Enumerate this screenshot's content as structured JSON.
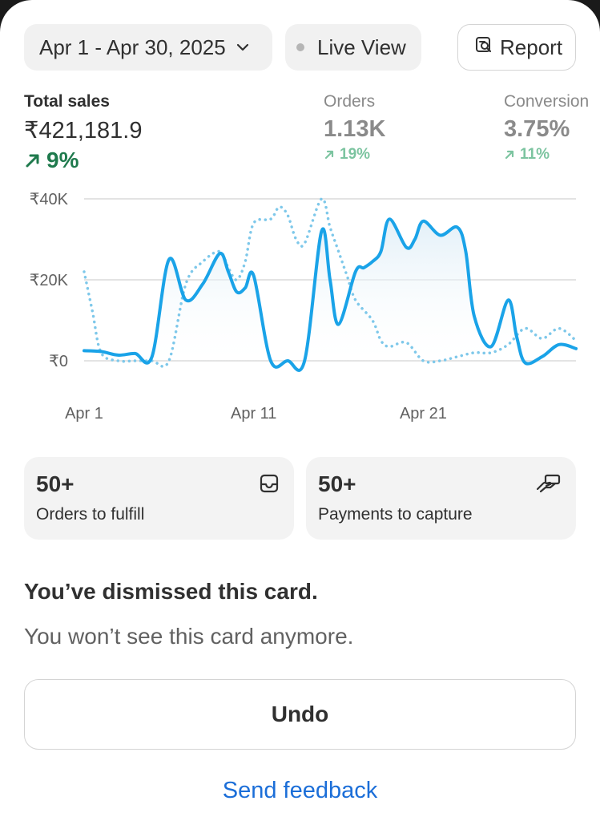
{
  "header": {
    "date_range": "Apr 1 - Apr 30, 2025",
    "live_view": "Live View",
    "report": "Report"
  },
  "metrics": [
    {
      "label": "Total sales",
      "value": "₹421,181.9",
      "delta": "9%"
    },
    {
      "label": "Orders",
      "value": "1.13K",
      "delta": "19%"
    },
    {
      "label": "Conversion",
      "value": "3.75%",
      "delta": "11%"
    }
  ],
  "colors": {
    "series_current": "#1aa3e8",
    "series_previous": "#7ec8ea",
    "positive": "#1f7a4d",
    "positive_muted": "#7cc4a0",
    "link": "#1b6ed8"
  },
  "chart_data": {
    "type": "line",
    "yticks": [
      "₹40K",
      "₹20K",
      "₹0"
    ],
    "xticks": [
      "Apr 1",
      "Apr 11",
      "Apr 21"
    ],
    "ylim": [
      0,
      40000
    ],
    "xlim": [
      1,
      30
    ],
    "grid": true,
    "series": [
      {
        "style": "solid",
        "x": [
          1,
          2,
          3,
          4,
          5,
          6,
          7,
          8,
          9,
          9.5,
          10,
          10.5,
          11,
          12,
          13,
          14,
          15,
          15.5,
          16,
          17,
          17.5,
          18,
          18.5,
          19,
          20,
          20.5,
          21,
          22,
          23,
          23.5,
          24,
          25,
          26,
          26.5,
          27,
          28,
          29,
          30
        ],
        "values": [
          2500,
          2300,
          1400,
          1800,
          1000,
          25000,
          15000,
          19000,
          26500,
          22000,
          17000,
          18000,
          21000,
          0,
          0,
          0,
          32000,
          20000,
          9000,
          22000,
          23000,
          24500,
          27000,
          35000,
          28000,
          30000,
          34500,
          31000,
          33000,
          27000,
          11000,
          3500,
          15000,
          6000,
          -500,
          1000,
          4000,
          3000
        ]
      },
      {
        "style": "dotted",
        "x": [
          1,
          1.5,
          2,
          3,
          4,
          5,
          6,
          7,
          8,
          9,
          9.5,
          10,
          10.5,
          11,
          12,
          12.5,
          13,
          13.5,
          14,
          15,
          15.5,
          16,
          16.5,
          17,
          18,
          18.5,
          19,
          20,
          21,
          22,
          23,
          24,
          25,
          26,
          27,
          28,
          29,
          30
        ],
        "values": [
          22000,
          12000,
          2000,
          0,
          0,
          0,
          0,
          19000,
          24500,
          27000,
          23000,
          20000,
          24500,
          34000,
          35000,
          38000,
          36000,
          30000,
          29000,
          40000,
          33000,
          27000,
          21000,
          15000,
          10000,
          5000,
          3500,
          4500,
          0,
          0,
          1000,
          2000,
          2000,
          4000,
          8000,
          5500,
          8000,
          5000
        ]
      }
    ]
  },
  "cards": [
    {
      "value": "50+",
      "label": "Orders to fulfill",
      "icon": "inbox-icon"
    },
    {
      "value": "50+",
      "label": "Payments to capture",
      "icon": "payment-hand-icon"
    }
  ],
  "dismissed": {
    "title": "You’ve dismissed this card.",
    "subtitle": "You won’t see this card anymore.",
    "undo": "Undo",
    "feedback": "Send feedback"
  }
}
